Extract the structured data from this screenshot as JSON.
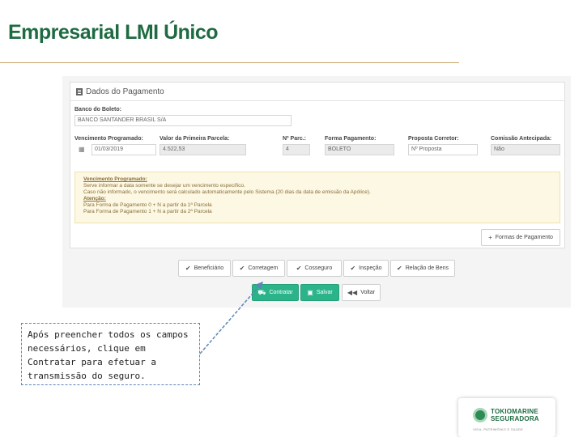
{
  "slide": {
    "title": "Empresarial LMI Único"
  },
  "panel": {
    "title": "Dados do Pagamento",
    "bank": {
      "label": "Banco do Boleto:",
      "value": "BANCO SANTANDER BRASIL S/A"
    },
    "fields": [
      {
        "label": "Vencimento Programado:",
        "value": "01/03/2019"
      },
      {
        "label": "Valor da Primeira Parcela:",
        "value": "4.522,53"
      },
      {
        "label": "Nº Parc.:",
        "value": "4"
      },
      {
        "label": "Forma Pagamento:",
        "value": "BOLETO"
      },
      {
        "label": "Proposta Corretor:",
        "value": "Nº Proposta"
      },
      {
        "label": "Comissão Antecipada:",
        "value": "Não"
      }
    ],
    "alert": {
      "heading1": "Vencimento Programado:",
      "line1": "Serve informar a data somente se desejar um vencimento específico.",
      "line2": "Caso não informado, o vencimento será calculado automaticamente pelo Sistema (20 dias da data de emissão da Apólice).",
      "heading2": "Atenção:",
      "line3": "Para Forma de Pagamento 0 + N a partir da 1ª Parcela",
      "line4": "Para Forma de Pagamento 1 + N a partir da 2ª Parcela"
    },
    "formas_button": "Formas de Pagamento"
  },
  "tabs": [
    {
      "label": "Beneficiário"
    },
    {
      "label": "Corretagem"
    },
    {
      "label": "Cosseguro"
    },
    {
      "label": "Inspeção"
    },
    {
      "label": "Relação de Bens"
    }
  ],
  "actions": {
    "contratar": "Contratar",
    "salvar": "Salvar",
    "voltar": "Voltar"
  },
  "callout": {
    "text": "Após preencher todos os campos necessários, clique em Contratar para efetuar a transmissão do seguro."
  },
  "logo": {
    "line1": "TOKIOMARINE",
    "line2": "SEGURADORA",
    "tagline": "VIDA, PATRIMÔNIO E SAÚDE"
  },
  "colors": {
    "brand_green": "#1e6b42",
    "button_green": "#2bb48a",
    "alert_bg": "#fcf8e3",
    "callout_border": "#5b86b8"
  },
  "icons": [
    "document-icon",
    "calendar-icon",
    "plus-icon",
    "check-icon",
    "cart-icon",
    "save-icon",
    "back-icon"
  ]
}
